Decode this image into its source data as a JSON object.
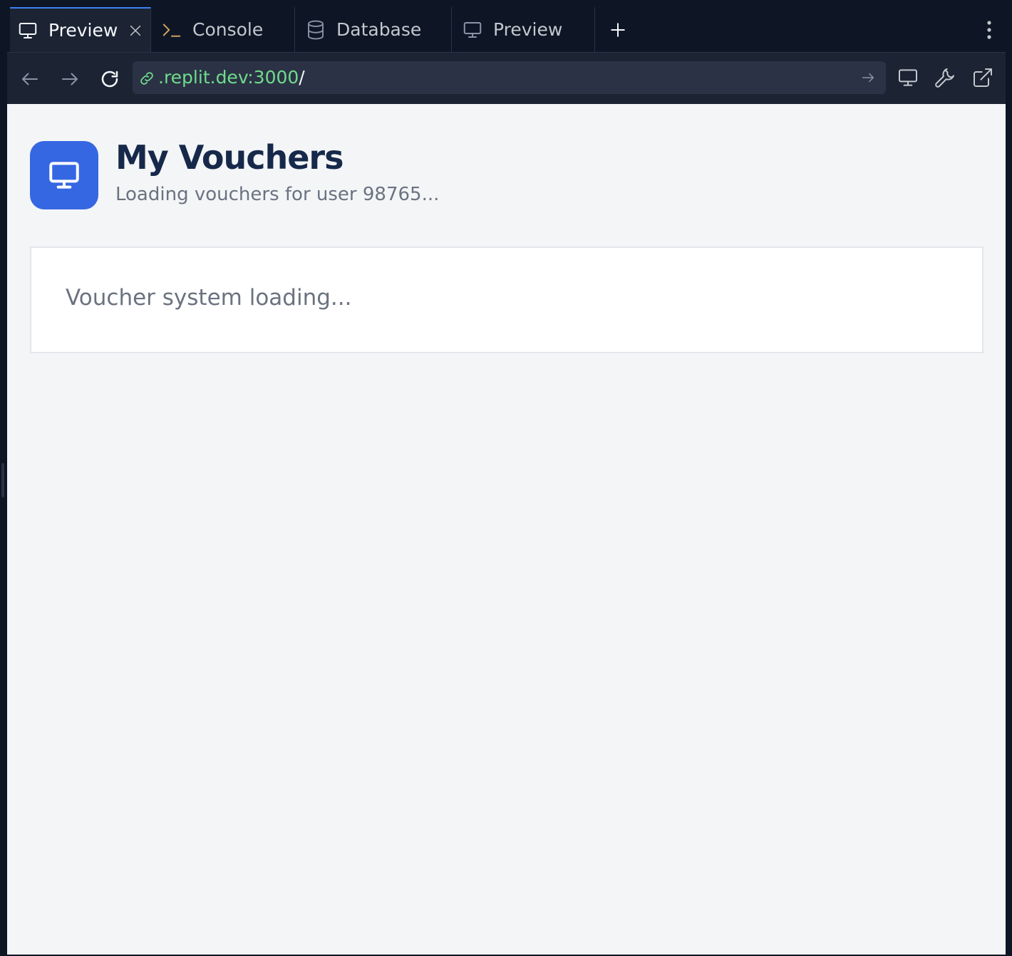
{
  "tabs": [
    {
      "label": "Preview",
      "icon": "monitor-icon",
      "active": true
    },
    {
      "label": "Console",
      "icon": "terminal-icon",
      "active": false
    },
    {
      "label": "Database",
      "icon": "database-icon",
      "active": false
    },
    {
      "label": "Preview",
      "icon": "monitor-icon",
      "active": false
    }
  ],
  "address_bar": {
    "host": ".replit.dev:3000",
    "path": "/"
  },
  "page": {
    "title": "My Vouchers",
    "subtitle": "Loading vouchers for user 98765...",
    "status_message": "Voucher system loading..."
  },
  "colors": {
    "accent": "#3667e2",
    "url_host": "#6fdc8c",
    "title": "#17294a",
    "muted_text": "#6b7280",
    "page_background": "#f3f5f7",
    "chrome_dark": "#0e1525"
  }
}
